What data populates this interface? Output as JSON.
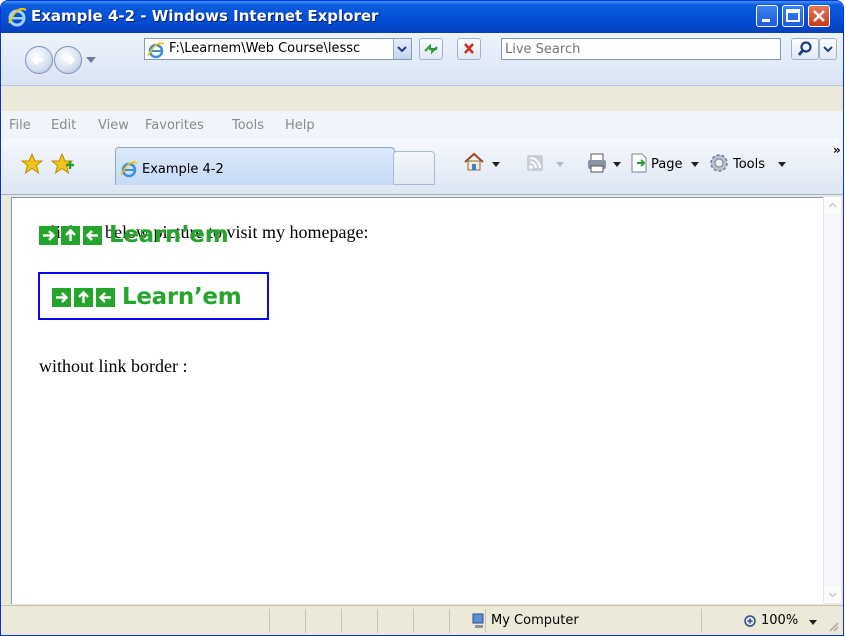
{
  "window": {
    "title": "Example 4-2 - Windows Internet Explorer"
  },
  "address_bar": {
    "url": "F:\\Learnem\\Web Course\\lessc"
  },
  "search": {
    "placeholder": "Live Search"
  },
  "menu": {
    "items": [
      "File",
      "Edit",
      "View",
      "Favorites",
      "Tools",
      "Help"
    ]
  },
  "tab": {
    "label": "Example 4-2"
  },
  "command_bar": {
    "page_label": "Page",
    "tools_label": "Tools",
    "more": "»"
  },
  "content": {
    "instruction": "Click on below picture to visit my homepage:",
    "no_border_label": "without link border :",
    "logo_text": "Learn’em",
    "logo_color": "#26a52d",
    "link_border_color": "#0a0af0"
  },
  "status": {
    "zone": "My Computer",
    "zoom": "100%"
  },
  "colors": {
    "titlebar": "#0551d7",
    "chrome": "#ece9d8"
  }
}
